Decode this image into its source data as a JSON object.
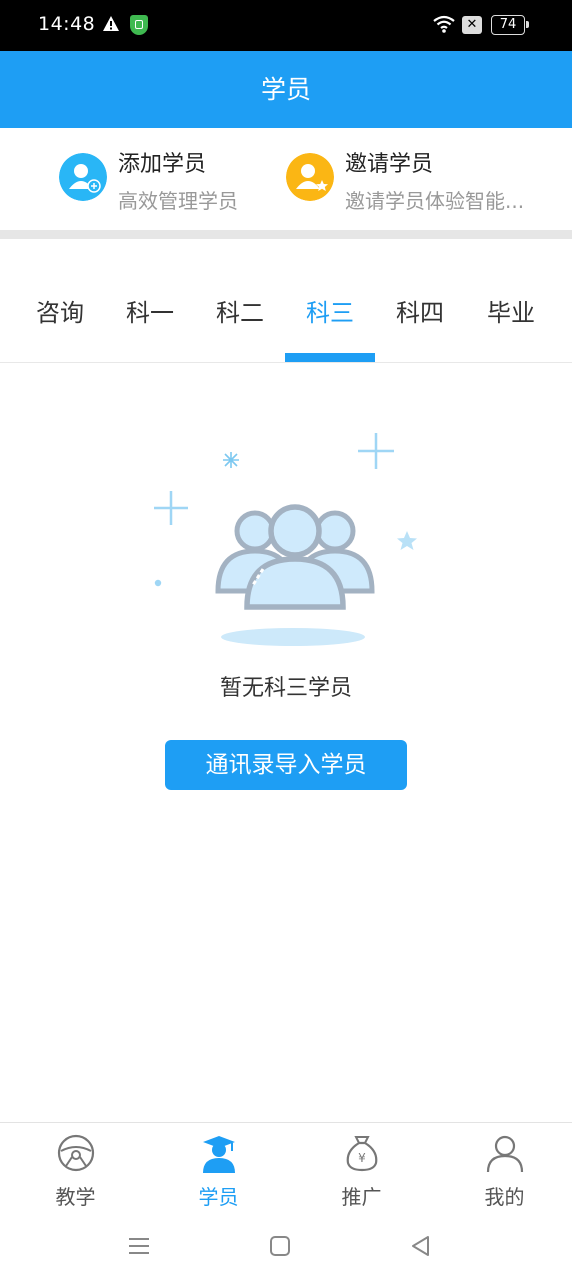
{
  "status": {
    "time": "14:48",
    "battery": "74"
  },
  "header": {
    "title": "学员"
  },
  "quick_actions": [
    {
      "title": "添加学员",
      "subtitle": "高效管理学员"
    },
    {
      "title": "邀请学员",
      "subtitle": "邀请学员体验智能..."
    }
  ],
  "tabs": [
    {
      "label": "咨询"
    },
    {
      "label": "科一"
    },
    {
      "label": "科二"
    },
    {
      "label": "科三"
    },
    {
      "label": "科四"
    },
    {
      "label": "毕业"
    }
  ],
  "active_tab": "科三",
  "empty_state": {
    "message": "暂无科三学员",
    "button_label": "通讯录导入学员"
  },
  "bottom_nav": [
    {
      "label": "教学",
      "icon": "steering-wheel-icon"
    },
    {
      "label": "学员",
      "icon": "graduate-icon"
    },
    {
      "label": "推广",
      "icon": "money-bag-icon"
    },
    {
      "label": "我的",
      "icon": "user-icon"
    }
  ],
  "colors": {
    "primary": "#1e9ef4",
    "add_icon": "#29b6f6",
    "invite_icon": "#fbb614"
  }
}
